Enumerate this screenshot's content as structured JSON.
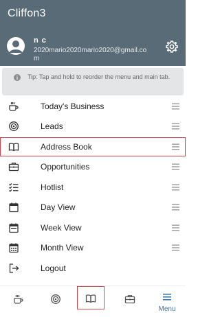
{
  "header": {
    "app_title": "Cliffon3",
    "user_name": "n c",
    "user_email": "2020mario2020mario2020@gmail.com",
    "avatar_icon": "person-icon",
    "settings_icon": "gear-icon"
  },
  "tip": {
    "icon": "info-icon",
    "text": "Tip: Tap and hold to reorder the menu and main tab."
  },
  "menu": {
    "items": [
      {
        "label": "Today's Business",
        "icon": "coffee-cup-icon"
      },
      {
        "label": "Leads",
        "icon": "target-icon"
      },
      {
        "label": "Address Book",
        "icon": "book-icon"
      },
      {
        "label": "Opportunities",
        "icon": "briefcase-icon"
      },
      {
        "label": "Hotlist",
        "icon": "checklist-icon"
      },
      {
        "label": "Day View",
        "icon": "calendar-day-icon"
      },
      {
        "label": "Week View",
        "icon": "calendar-week-icon"
      },
      {
        "label": "Month View",
        "icon": "calendar-month-icon"
      },
      {
        "label": "Logout",
        "icon": "logout-icon"
      }
    ],
    "handle_icon": "drag-handle-icon"
  },
  "bottom_nav": {
    "items": [
      {
        "icon": "coffee-cup-icon"
      },
      {
        "icon": "target-icon"
      },
      {
        "icon": "book-icon"
      },
      {
        "icon": "briefcase-icon"
      },
      {
        "icon": "menu-icon",
        "label": "Menu"
      }
    ]
  },
  "colors": {
    "header_bg": "#5a6b78",
    "tip_bg": "#e3e5e7",
    "selection_outline": "#d0464b",
    "menu_accent": "#3d78b3"
  }
}
